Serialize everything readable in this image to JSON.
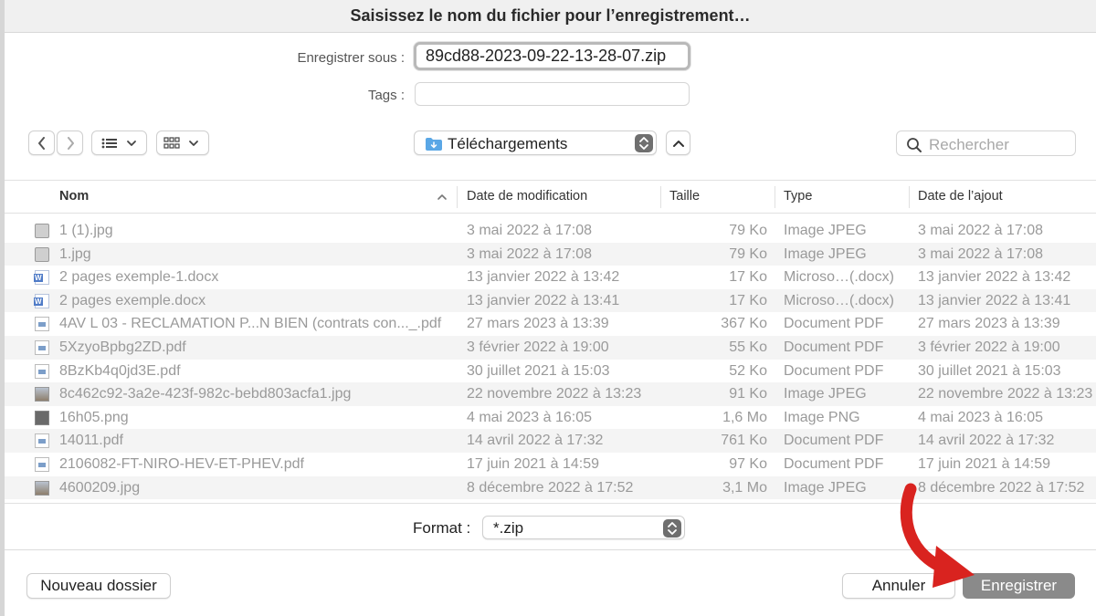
{
  "window": {
    "title": "Saisissez le nom du fichier pour l’enregistrement…"
  },
  "form": {
    "save_as_label": "Enregistrer sous :",
    "filename": "89cd88-2023-09-22-13-28-07.zip",
    "tags_label": "Tags :",
    "tags_value": ""
  },
  "toolbar": {
    "location": "Téléchargements",
    "search_placeholder": "Rechercher"
  },
  "table": {
    "columns": [
      "Nom",
      "Date de modification",
      "Taille",
      "Type",
      "Date de l’ajout"
    ],
    "rows": [
      {
        "icon": "jpg-file-icon",
        "name": "1 (1).jpg",
        "modified": "3 mai 2022 à 17:08",
        "size": "79 Ko",
        "type": "Image JPEG",
        "added": "3 mai 2022 à 17:08"
      },
      {
        "icon": "jpg-file-icon",
        "name": "1.jpg",
        "modified": "3 mai 2022 à 17:08",
        "size": "79 Ko",
        "type": "Image JPEG",
        "added": "3 mai 2022 à 17:08"
      },
      {
        "icon": "word-file-icon",
        "name": "2 pages exemple-1.docx",
        "modified": "13 janvier 2022 à 13:42",
        "size": "17 Ko",
        "type": "Microso…(.docx)",
        "added": "13 janvier 2022 à 13:42"
      },
      {
        "icon": "word-file-icon",
        "name": "2 pages exemple.docx",
        "modified": "13 janvier 2022 à 13:41",
        "size": "17 Ko",
        "type": "Microso…(.docx)",
        "added": "13 janvier 2022 à 13:41"
      },
      {
        "icon": "pdf-file-icon",
        "name": "4AV L 03 - RECLAMATION P...N BIEN (contrats con..._.pdf",
        "modified": "27 mars 2023 à 13:39",
        "size": "367 Ko",
        "type": "Document PDF",
        "added": "27 mars 2023 à 13:39"
      },
      {
        "icon": "pdf-file-icon",
        "name": "5XzyoBpbg2ZD.pdf",
        "modified": "3 février 2022 à 19:00",
        "size": "55 Ko",
        "type": "Document PDF",
        "added": "3 février 2022 à 19:00"
      },
      {
        "icon": "pdf-file-icon",
        "name": "8BzKb4q0jd3E.pdf",
        "modified": "30 juillet 2021 à 15:03",
        "size": "52 Ko",
        "type": "Document PDF",
        "added": "30 juillet 2021 à 15:03"
      },
      {
        "icon": "photo-file-icon",
        "name": "8c462c92-3a2e-423f-982c-bebd803acfa1.jpg",
        "modified": "22 novembre 2022 à 13:23",
        "size": "91 Ko",
        "type": "Image JPEG",
        "added": "22 novembre 2022 à 13:23"
      },
      {
        "icon": "png-file-icon",
        "name": "16h05.png",
        "modified": "4 mai 2023 à 16:05",
        "size": "1,6 Mo",
        "type": "Image PNG",
        "added": "4 mai 2023 à 16:05"
      },
      {
        "icon": "pdf-file-icon",
        "name": "14011.pdf",
        "modified": "14 avril 2022 à 17:32",
        "size": "761 Ko",
        "type": "Document PDF",
        "added": "14 avril 2022 à 17:32"
      },
      {
        "icon": "pdf-file-icon",
        "name": "2106082-FT-NIRO-HEV-ET-PHEV.pdf",
        "modified": "17 juin 2021 à 14:59",
        "size": "97 Ko",
        "type": "Document PDF",
        "added": "17 juin 2021 à 14:59"
      },
      {
        "icon": "photo-file-icon",
        "name": "4600209.jpg",
        "modified": "8 décembre 2022 à 17:52",
        "size": "3,1 Mo",
        "type": "Image JPEG",
        "added": "8 décembre 2022 à 17:52"
      }
    ]
  },
  "format": {
    "label": "Format :",
    "value": "*.zip"
  },
  "footer": {
    "new_folder": "Nouveau dossier",
    "cancel": "Annuler",
    "save": "Enregistrer"
  },
  "colors": {
    "annotation_arrow": "#d9231f",
    "primary_button": "#8a8a8a"
  }
}
